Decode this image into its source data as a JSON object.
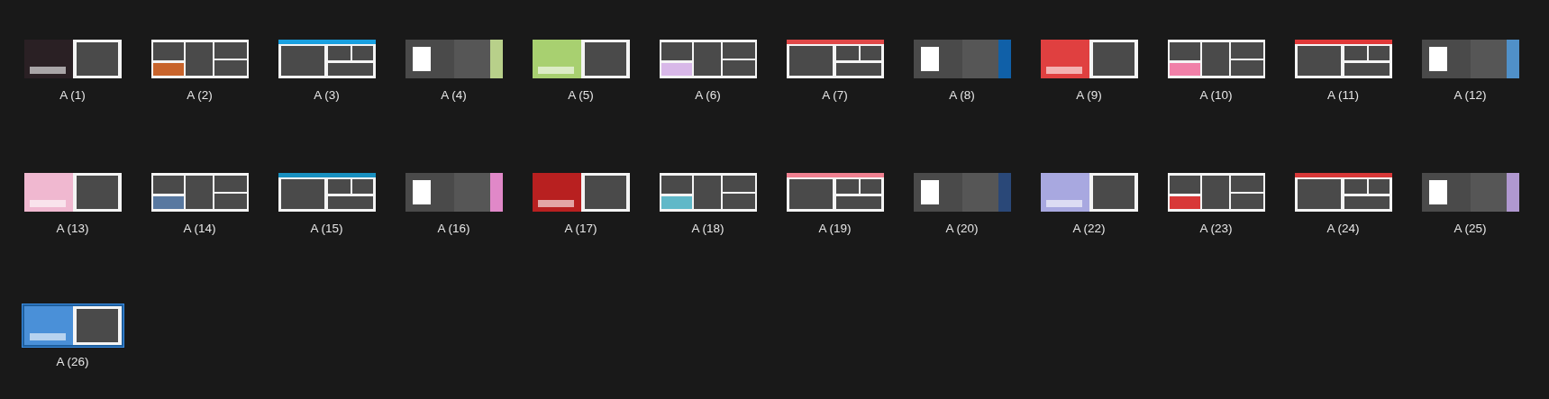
{
  "files": [
    {
      "name": "A (1)",
      "selected": false
    },
    {
      "name": "A (2)",
      "selected": false
    },
    {
      "name": "A (3)",
      "selected": false
    },
    {
      "name": "A (4)",
      "selected": false
    },
    {
      "name": "A (5)",
      "selected": false
    },
    {
      "name": "A (6)",
      "selected": false
    },
    {
      "name": "A (7)",
      "selected": false
    },
    {
      "name": "A (8)",
      "selected": false
    },
    {
      "name": "A (9)",
      "selected": false
    },
    {
      "name": "A (10)",
      "selected": false
    },
    {
      "name": "A (11)",
      "selected": false
    },
    {
      "name": "A (12)",
      "selected": false
    },
    {
      "name": "A (13)",
      "selected": false
    },
    {
      "name": "A (14)",
      "selected": false
    },
    {
      "name": "A (15)",
      "selected": false
    },
    {
      "name": "A (16)",
      "selected": false
    },
    {
      "name": "A (17)",
      "selected": false
    },
    {
      "name": "A (18)",
      "selected": false
    },
    {
      "name": "A (19)",
      "selected": false
    },
    {
      "name": "A (20)",
      "selected": false
    },
    {
      "name": "A (22)",
      "selected": false
    },
    {
      "name": "A (23)",
      "selected": false
    },
    {
      "name": "A (24)",
      "selected": false
    },
    {
      "name": "A (25)",
      "selected": false
    },
    {
      "name": "A (26)",
      "selected": true
    }
  ]
}
